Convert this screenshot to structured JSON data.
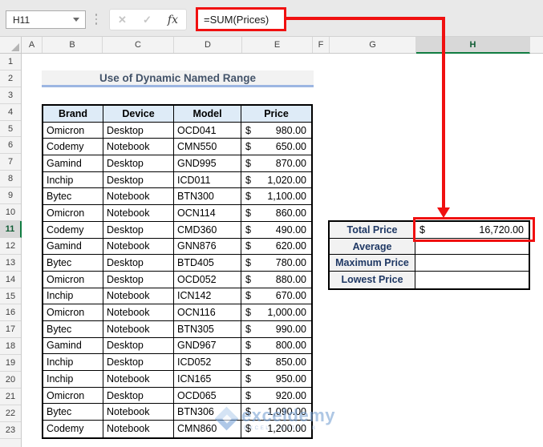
{
  "toolbar": {
    "name_box_value": "H11",
    "formula": "=SUM(Prices)",
    "cancel_icon": "✕",
    "enter_icon": "✓",
    "fx_icon": "fx"
  },
  "grid": {
    "column_letters": [
      "A",
      "B",
      "C",
      "D",
      "E",
      "F",
      "G",
      "H"
    ],
    "selected_column": "H",
    "selected_row": 11,
    "rows_visible": 23
  },
  "title_banner": {
    "text": "Use of Dynamic Named Range"
  },
  "products_table": {
    "headers": [
      "Brand",
      "Device",
      "Model",
      "Price"
    ],
    "currency_symbol": "$",
    "rows": [
      {
        "brand": "Omicron",
        "device": "Desktop",
        "model": "OCD041",
        "price": "980.00"
      },
      {
        "brand": "Codemy",
        "device": "Notebook",
        "model": "CMN550",
        "price": "650.00"
      },
      {
        "brand": "Gamind",
        "device": "Desktop",
        "model": "GND995",
        "price": "870.00"
      },
      {
        "brand": "Inchip",
        "device": "Desktop",
        "model": "ICD011",
        "price": "1,020.00"
      },
      {
        "brand": "Bytec",
        "device": "Notebook",
        "model": "BTN300",
        "price": "1,100.00"
      },
      {
        "brand": "Omicron",
        "device": "Notebook",
        "model": "OCN114",
        "price": "860.00"
      },
      {
        "brand": "Codemy",
        "device": "Desktop",
        "model": "CMD360",
        "price": "490.00"
      },
      {
        "brand": "Gamind",
        "device": "Notebook",
        "model": "GNN876",
        "price": "620.00"
      },
      {
        "brand": "Bytec",
        "device": "Desktop",
        "model": "BTD405",
        "price": "780.00"
      },
      {
        "brand": "Omicron",
        "device": "Desktop",
        "model": "OCD052",
        "price": "880.00"
      },
      {
        "brand": "Inchip",
        "device": "Notebook",
        "model": "ICN142",
        "price": "670.00"
      },
      {
        "brand": "Omicron",
        "device": "Notebook",
        "model": "OCN116",
        "price": "1,000.00"
      },
      {
        "brand": "Bytec",
        "device": "Notebook",
        "model": "BTN305",
        "price": "990.00"
      },
      {
        "brand": "Gamind",
        "device": "Desktop",
        "model": "GND967",
        "price": "800.00"
      },
      {
        "brand": "Inchip",
        "device": "Desktop",
        "model": "ICD052",
        "price": "850.00"
      },
      {
        "brand": "Inchip",
        "device": "Notebook",
        "model": "ICN165",
        "price": "950.00"
      },
      {
        "brand": "Omicron",
        "device": "Desktop",
        "model": "OCD065",
        "price": "920.00"
      },
      {
        "brand": "Bytec",
        "device": "Notebook",
        "model": "BTN306",
        "price": "1,090.00"
      },
      {
        "brand": "Codemy",
        "device": "Notebook",
        "model": "CMN860",
        "price": "1,200.00"
      }
    ]
  },
  "summary_table": {
    "rows": [
      {
        "label": "Total Price",
        "currency": "$",
        "value": "16,720.00",
        "highlighted": true
      },
      {
        "label": "Average",
        "currency": "",
        "value": "",
        "highlighted": false
      },
      {
        "label": "Maximum Price",
        "currency": "",
        "value": "",
        "highlighted": false
      },
      {
        "label": "Lowest Price",
        "currency": "",
        "value": "",
        "highlighted": false
      }
    ]
  },
  "watermark": {
    "text": "exceldemy",
    "tagline": "EXCEL · DATA · B"
  },
  "colors": {
    "annotation_red": "#F01010",
    "selection_green": "#107C41",
    "table_header_fill": "#DEEBF7",
    "summary_label_fill": "#F2F2F2",
    "summary_label_text": "#1F3864",
    "title_fill": "#F2F2F2",
    "title_text": "#44546A",
    "title_underline": "#9CB6E2",
    "header_fill": "#F3F3F3",
    "selected_header_fill": "#D8D8D8"
  }
}
